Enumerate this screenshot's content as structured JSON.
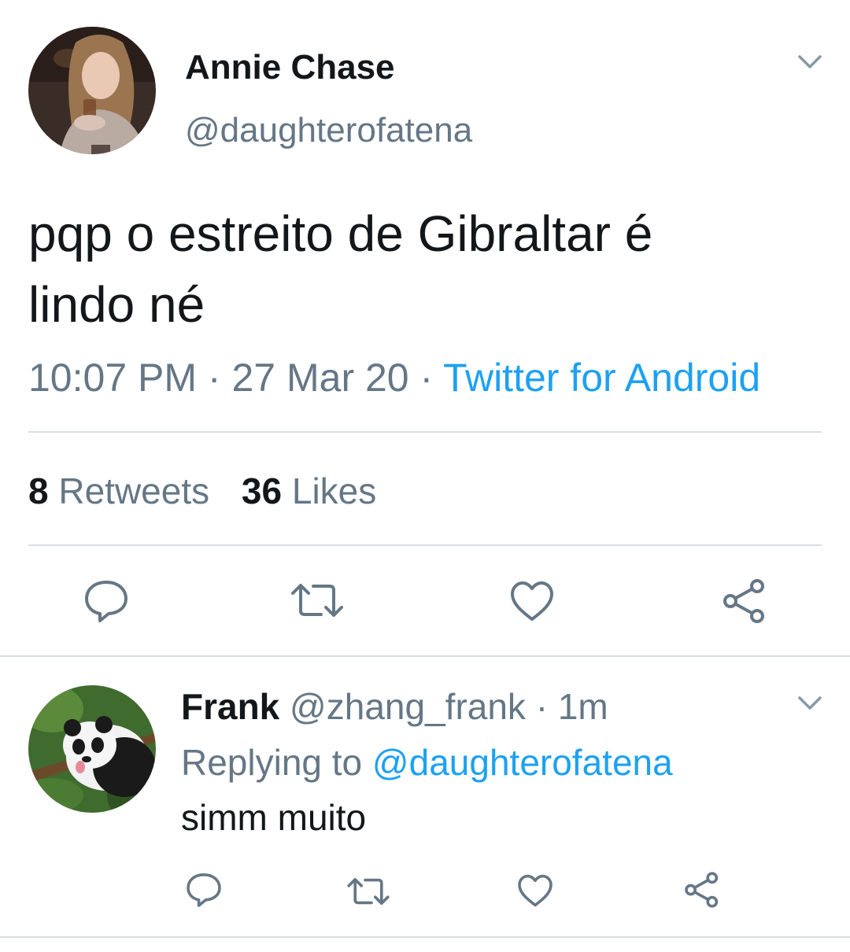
{
  "main_tweet": {
    "author_name": "Annie Chase",
    "author_handle": "@daughterofatena",
    "text_line1": "pqp o estreito de Gibraltar é",
    "text_line2": "lindo né",
    "time": "10:07 PM",
    "date": "27 Mar 20",
    "separator": "·",
    "source": "Twitter for Android",
    "retweet_count": "8",
    "retweet_label": "Retweets",
    "like_count": "36",
    "like_label": "Likes",
    "icons": [
      "reply-icon",
      "retweet-icon",
      "like-icon",
      "share-icon",
      "chevron-down-icon"
    ]
  },
  "reply": {
    "author_name": "Frank",
    "author_handle": "@zhang_frank",
    "separator": "·",
    "time_ago": "1m",
    "replying_prefix": "Replying to",
    "replying_handle": "@daughterofatena",
    "text": "simm muito",
    "icons": [
      "reply-icon",
      "retweet-icon",
      "like-icon",
      "share-icon",
      "chevron-down-icon"
    ]
  },
  "colors": {
    "text": "#14171a",
    "secondary": "#657786",
    "accent": "#1da1f2",
    "divider": "#d8dde2"
  }
}
